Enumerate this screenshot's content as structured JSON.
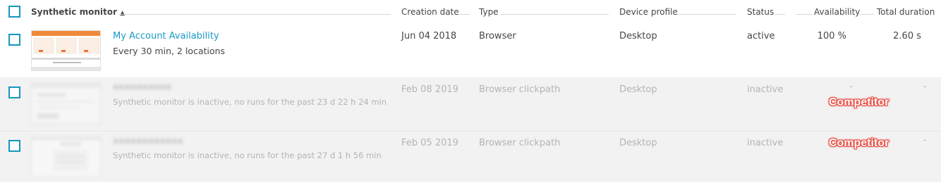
{
  "header": {
    "synthetic_monitor": "Synthetic monitor",
    "sort_indicator": "▲",
    "creation_date": "Creation date",
    "type": "Type",
    "device_profile": "Device profile",
    "status": "Status",
    "availability": "Availability",
    "total_duration": "Total duration"
  },
  "rows": [
    {
      "name": "My Account Availability",
      "subtitle": "Every 30 min, 2 locations",
      "creation_date": "Jun 04 2018",
      "type": "Browser",
      "device_profile": "Desktop",
      "status": "active",
      "availability": "100 %",
      "total_duration": "2.60 s"
    },
    {
      "name": "••••••••••",
      "subtitle": "Synthetic monitor is inactive, no runs for the past 23 d 22 h 24 min",
      "creation_date": "Feb 08 2019",
      "type": "Browser clickpath",
      "device_profile": "Desktop",
      "status": "inactive",
      "availability": "-",
      "total_duration": "-",
      "annotation": "Competitor"
    },
    {
      "name": "••••••••••••",
      "subtitle": "Synthetic monitor is inactive, no runs for the past 27 d 1 h 56 min",
      "creation_date": "Feb 05 2019",
      "type": "Browser clickpath",
      "device_profile": "Desktop",
      "status": "inactive",
      "availability": "-",
      "total_duration": "-",
      "annotation": "Competitor"
    }
  ],
  "colors": {
    "accent": "#1497bd",
    "link": "#1a9ac6",
    "annotation": "#e8453c",
    "inactive_row_bg": "#f2f2f2"
  },
  "icons": {
    "sort": "sort-ascending-icon",
    "checkbox": "checkbox-icon"
  }
}
